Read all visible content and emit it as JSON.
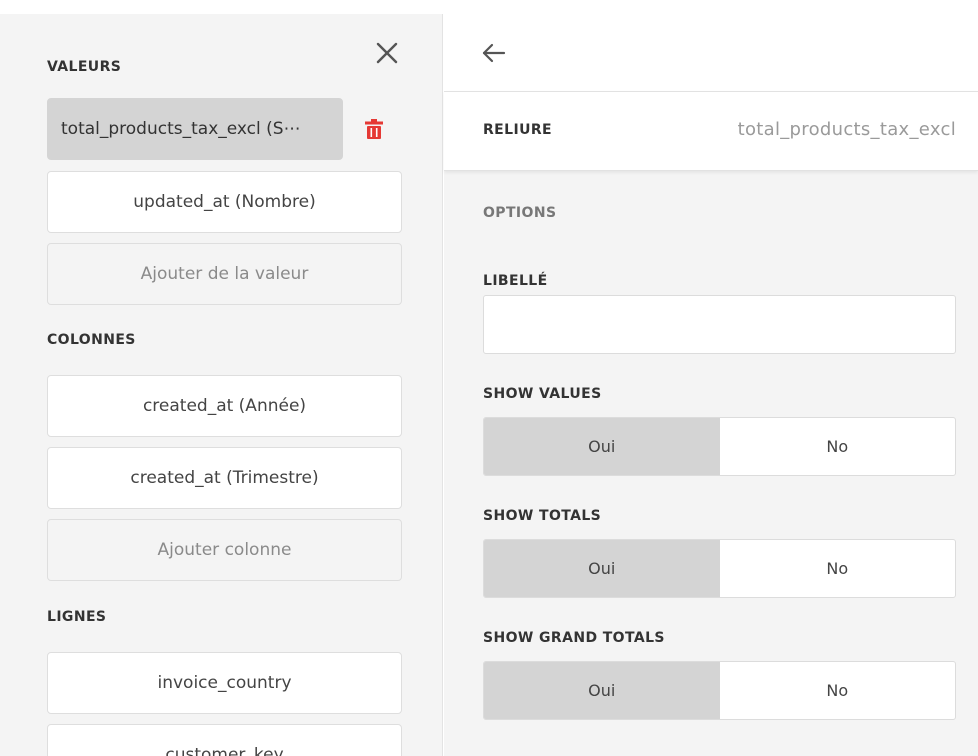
{
  "left": {
    "values_title": "VALEURS",
    "values_items": [
      "total_products_tax_excl (S⋯",
      "updated_at (Nombre)"
    ],
    "values_add": "Ajouter de la valeur",
    "columns_title": "COLONNES",
    "columns_items": [
      "created_at (Année)",
      "created_at (Trimestre)"
    ],
    "columns_add": "Ajouter colonne",
    "rows_title": "LIGNES",
    "rows_items": [
      "invoice_country",
      "customer_key"
    ]
  },
  "right": {
    "binding_label": "RELIURE",
    "binding_value": "total_products_tax_excl",
    "options_title": "OPTIONS",
    "label_title": "LIBELLÉ",
    "label_value": "",
    "show_values": {
      "title": "SHOW VALUES",
      "yes": "Oui",
      "no": "No",
      "selected": "yes"
    },
    "show_totals": {
      "title": "SHOW TOTALS",
      "yes": "Oui",
      "no": "No",
      "selected": "yes"
    },
    "show_grand_totals": {
      "title": "SHOW GRAND TOTALS",
      "yes": "Oui",
      "no": "No",
      "selected": "yes"
    }
  },
  "icons": {
    "close": "close-icon",
    "trash": "trash-icon",
    "back": "arrow-left-icon"
  },
  "colors": {
    "trash": "#e53935",
    "selected_toggle": "#d4d4d4",
    "panel_bg": "#f4f4f4"
  }
}
